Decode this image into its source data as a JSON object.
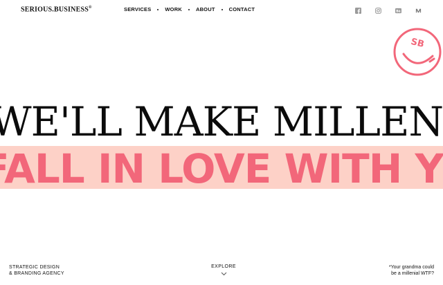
{
  "header": {
    "logo": "SERIOUS.BUSINESS",
    "logo_mark": "®",
    "nav": [
      {
        "label": "SERVICES"
      },
      {
        "label": "WORK"
      },
      {
        "label": "ABOUT"
      },
      {
        "label": "CONTACT"
      }
    ],
    "socials": [
      {
        "icon": "facebook-icon"
      },
      {
        "icon": "instagram-icon"
      },
      {
        "icon": "behance-icon"
      },
      {
        "icon": "medium-icon"
      }
    ]
  },
  "badge": {
    "text": "SB",
    "color": "#f2677a"
  },
  "hero": {
    "line1": "WE'LL MAKE MILLENNIALS",
    "line2": "FALL IN LOVE WITH YOUR BRAND",
    "accent": "#f2677a",
    "band_color": "#fdd1c7"
  },
  "footer": {
    "tagline_line1": "STRATEGIC DESIGN",
    "tagline_line2": "& BRANDING AGENCY",
    "explore": "EXPLORE",
    "note_line1": "*Your grandma could",
    "note_line2": "be a millenial WTF?"
  }
}
